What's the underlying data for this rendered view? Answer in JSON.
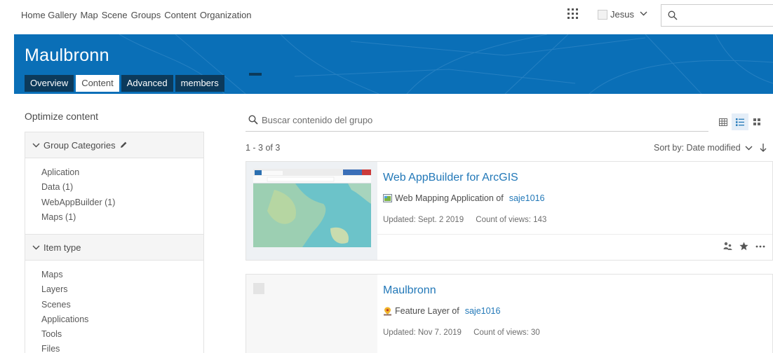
{
  "topnav": {
    "links": [
      "Home Gallery",
      "Map",
      "Scene",
      "Groups",
      "Content",
      "Organization"
    ],
    "user_name": "Jesus"
  },
  "banner": {
    "title": "Maulbronn",
    "tabs": [
      {
        "label": "Overview",
        "active": false
      },
      {
        "label": "Content",
        "active": true
      },
      {
        "label": "Advanced",
        "active": false
      },
      {
        "label": "members",
        "active": false
      }
    ]
  },
  "sidebar": {
    "optimize_label": "Optimize content",
    "group_categories": {
      "label": "Group Categories",
      "items": [
        "Aplication",
        "Data  (1)",
        "WebAppBuilder  (1)",
        "Maps  (1)"
      ]
    },
    "item_type": {
      "label": "Item type",
      "items": [
        "Maps",
        "Layers",
        "Scenes",
        "Applications",
        "Tools",
        "Files"
      ]
    }
  },
  "content": {
    "search_placeholder": "Buscar contenido del grupo",
    "count": "1 - 3 of 3",
    "sort_label": "Sort by: Date modified"
  },
  "items": [
    {
      "title": "Web AppBuilder for ArcGIS",
      "type_text": "Web Mapping Application of",
      "owner": "saje1016",
      "updated": "Updated: Sept. 2 2019",
      "views": "Count of views: 143"
    },
    {
      "title": "Maulbronn",
      "type_text": "Feature Layer of",
      "owner": "saje1016",
      "updated": "Updated: Nov 7. 2019",
      "views": "Count of views: 30"
    }
  ],
  "colors": {
    "banner": "#0a6fb7",
    "tab_dark": "#0c3a5b",
    "link": "#2278b8"
  }
}
